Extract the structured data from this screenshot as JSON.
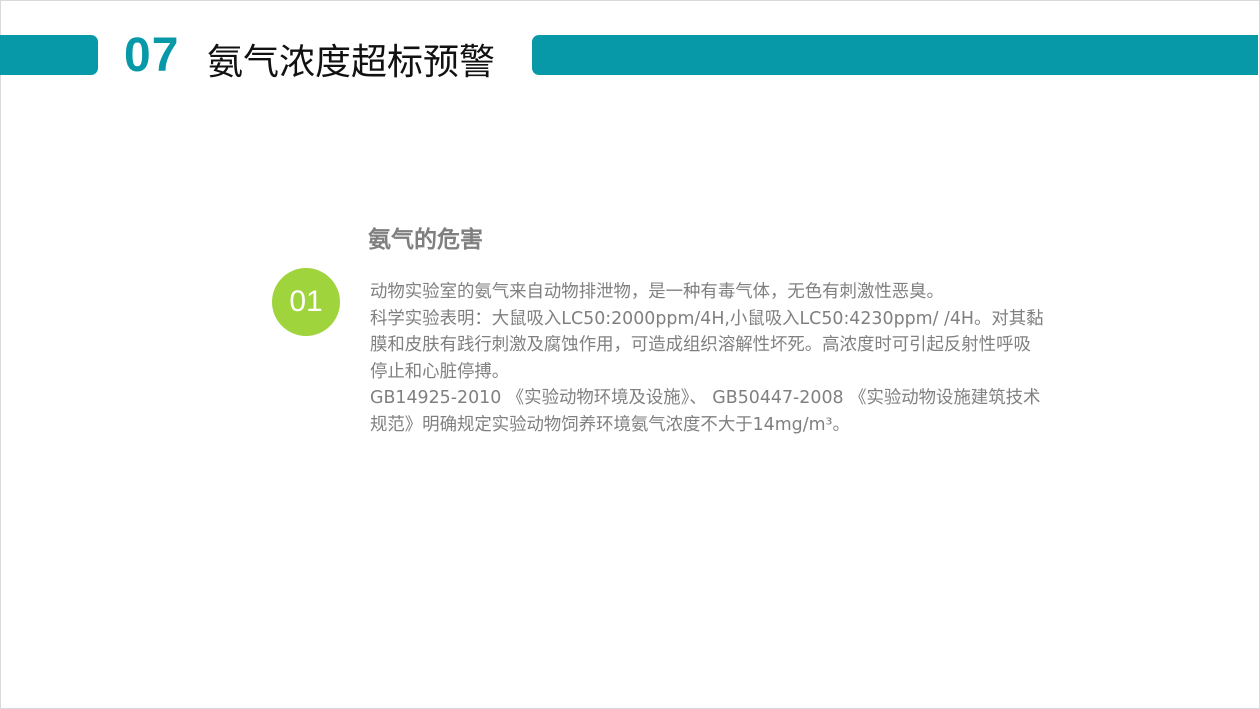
{
  "colors": {
    "accent": "#0899a8",
    "circle": "#9fd43c",
    "heading_gray": "#7f7f7f",
    "body_gray": "#808080"
  },
  "header": {
    "number": "07",
    "title": "氨气浓度超标预警"
  },
  "section": {
    "index": "01",
    "heading": "氨气的危害",
    "lines": [
      "动物实验室的氨气来自动物排泄物，是一种有毒气体，无色有刺激性恶臭。",
      "科学实验表明：大鼠吸入LC50:2000ppm/4H,小鼠吸入LC50:4230ppm/ /4H。对其黏",
      "膜和皮肤有践行刺激及腐蚀作用，可造成组织溶解性坏死。高浓度时可引起反射性呼吸",
      "停止和心脏停搏。",
      "GB14925-2010 《实验动物环境及设施》、 GB50447-2008 《实验动物设施建筑技术",
      "规范》明确规定实验动物饲养环境氨气浓度不大于14mg/m³。"
    ]
  }
}
